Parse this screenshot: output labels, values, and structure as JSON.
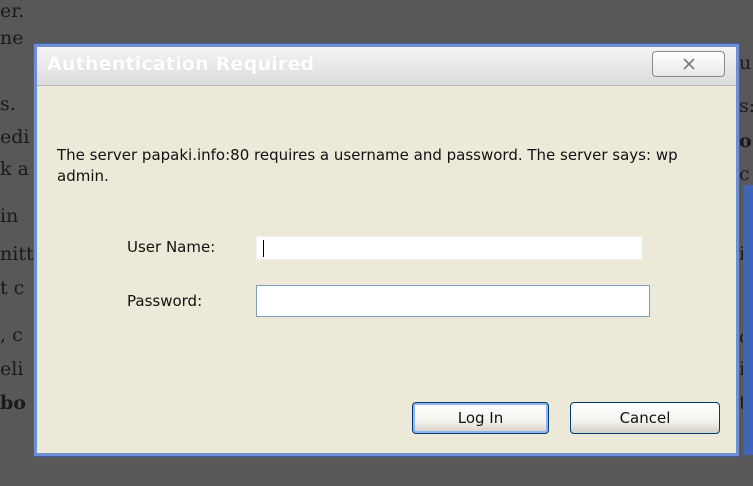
{
  "background": {
    "left_fragments": [
      "er.",
      "ne",
      "s.",
      "edi",
      "k a",
      "in",
      "nitt",
      "t c",
      ", c",
      "eli",
      "bo"
    ],
    "right_fragments": [
      "u",
      "s:",
      "o",
      "c",
      "",
      "if",
      "",
      "o",
      "ir",
      "t"
    ]
  },
  "dialog": {
    "title": "Authentication Required",
    "message": "The server papaki.info:80 requires a username and password. The server says: wp admin.",
    "username_label": "User Name:",
    "username_value": "",
    "password_label": "Password:",
    "password_value": "",
    "login_button": "Log In",
    "cancel_button": "Cancel",
    "icons": {
      "close": "close-icon"
    },
    "colors": {
      "dialog_bg": "#ece9d8",
      "border": "#6e8fd6",
      "title_text": "#ffffff",
      "default_button_border": "#003c74"
    }
  }
}
